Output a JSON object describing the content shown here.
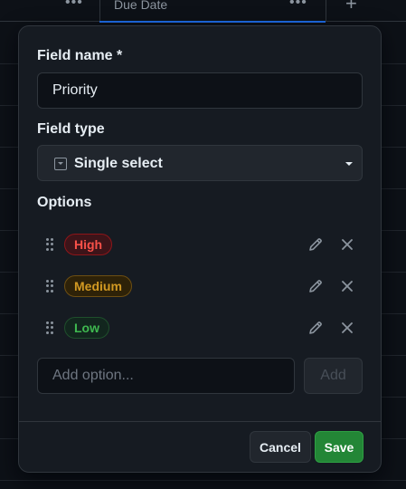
{
  "table": {
    "column_title": "Due Date",
    "column_menu_icon": "ellipsis-icon",
    "add_column_icon": "plus-icon"
  },
  "dialog": {
    "field_name_label": "Field name *",
    "field_name_value": "Priority",
    "field_type_label": "Field type",
    "field_type_value": "Single select",
    "field_type_icon": "single-select-icon",
    "options_label": "Options",
    "options": [
      {
        "label": "High",
        "color": "#f85149"
      },
      {
        "label": "Medium",
        "color": "#d29922"
      },
      {
        "label": "Low",
        "color": "#3fb950"
      }
    ],
    "add_option_placeholder": "Add option...",
    "add_button_label": "Add",
    "cancel_label": "Cancel",
    "save_label": "Save"
  },
  "colors": {
    "background": "#0d1117",
    "dialog": "#161b22",
    "accent": "#1f6feb",
    "save": "#238636"
  }
}
